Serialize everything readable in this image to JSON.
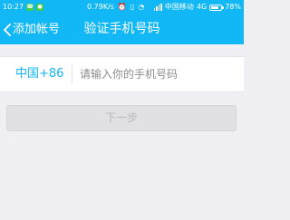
{
  "status_bar": {
    "time": "10:27",
    "speed": "0.79K/s",
    "carrier": "中国移动",
    "network": "4G",
    "battery": "78%",
    "left_icons": [
      "phone-call-icon",
      "wechat-icon"
    ],
    "right_icons": [
      "alarm-icon",
      "vibrate-icon",
      "wifi-icon",
      "signal-icon",
      "battery-icon"
    ]
  },
  "nav": {
    "back_label": "添加帐号",
    "title": "验证手机号码"
  },
  "form": {
    "country_code": "中国+86",
    "phone_placeholder": "请输入你的手机号码",
    "phone_value": ""
  },
  "actions": {
    "next_label": "下一步"
  },
  "colors": {
    "accent": "#12b7f5",
    "background": "#efeff4",
    "button_disabled_bg": "#e1e1e5",
    "button_disabled_text": "#b7b7bc"
  }
}
